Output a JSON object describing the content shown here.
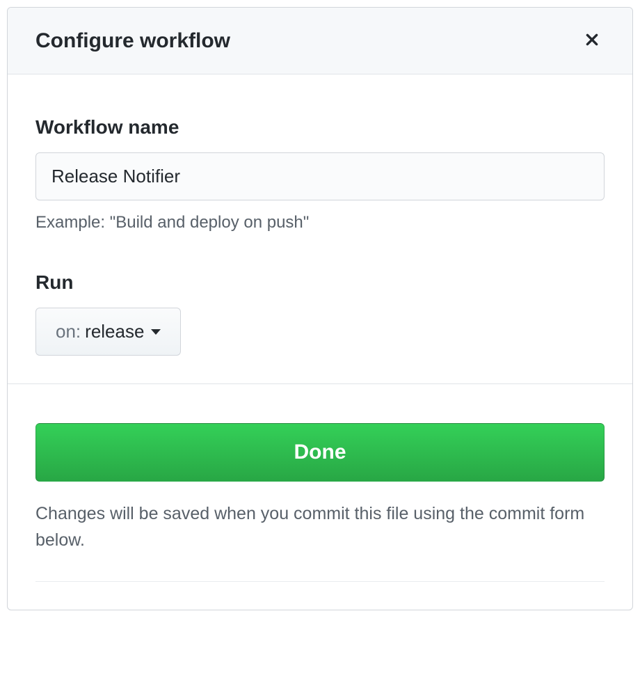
{
  "header": {
    "title": "Configure workflow"
  },
  "form": {
    "workflow_name": {
      "label": "Workflow name",
      "value": "Release Notifier",
      "example": "Example: \"Build and deploy on push\""
    },
    "run": {
      "label": "Run",
      "on_prefix": "on:",
      "selected": "release"
    }
  },
  "footer": {
    "done_label": "Done",
    "help_text": "Changes will be saved when you commit this file using the commit form below."
  }
}
